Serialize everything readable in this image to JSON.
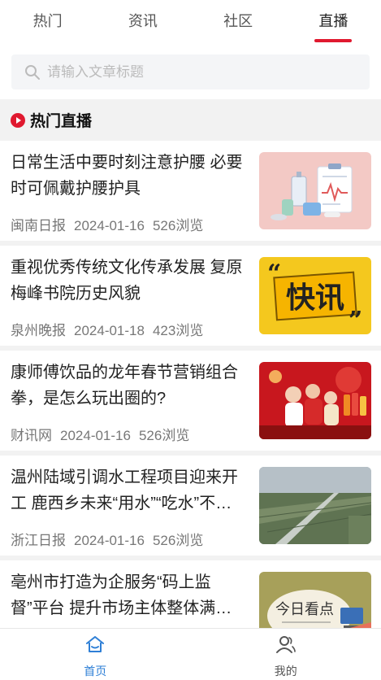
{
  "tabs": [
    {
      "label": "热门"
    },
    {
      "label": "资讯"
    },
    {
      "label": "社区"
    },
    {
      "label": "直播"
    }
  ],
  "active_tab": "直播",
  "search": {
    "placeholder": "请输入文章标题"
  },
  "section": {
    "title": "热门直播"
  },
  "articles": [
    {
      "title": "日常生活中要时刻注意护腰 必要时可佩戴护腰护具",
      "source": "闽南日报",
      "date": "2024-01-16",
      "views": "526浏览",
      "thumb": "medical-illustration"
    },
    {
      "title": "重视优秀传统文化传承发展 复原梅峰书院历史风貌",
      "source": "泉州晚报",
      "date": "2024-01-18",
      "views": "423浏览",
      "thumb": "news-flash",
      "thumb_text": "快讯"
    },
    {
      "title": "康师傅饮品的龙年春节营销组合拳，是怎么玩出圈的?",
      "source": "财讯网",
      "date": "2024-01-16",
      "views": "526浏览",
      "thumb": "family-new-year"
    },
    {
      "title": "温州陆域引调水工程项目迎来开工 鹿西乡未来“用水”“吃水”不用愁",
      "source": "浙江日报",
      "date": "2024-01-16",
      "views": "526浏览",
      "thumb": "aerial-landscape"
    },
    {
      "title": "亳州市打造为企服务“码上监督”平台 提升市场主体整体满意度",
      "source": "",
      "date": "",
      "views": "",
      "thumb": "today-watch",
      "thumb_text": "今日看点"
    }
  ],
  "bottom_nav": [
    {
      "label": "首页",
      "icon": "home-icon"
    },
    {
      "label": "我的",
      "icon": "user-icon"
    }
  ],
  "colors": {
    "accent": "#e0192f",
    "nav_active": "#2e7fd6"
  }
}
